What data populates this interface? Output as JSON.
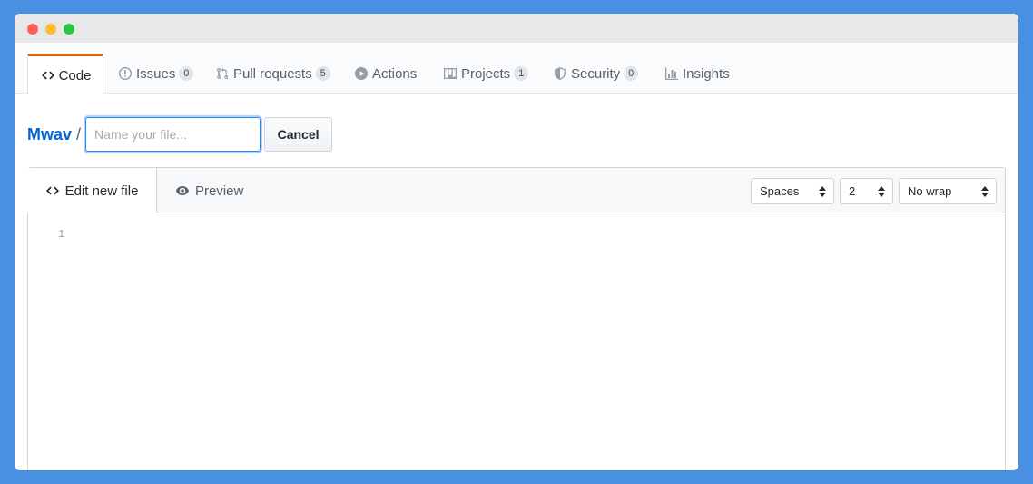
{
  "tabs": [
    {
      "label": "Code",
      "icon": "code-icon",
      "active": true
    },
    {
      "label": "Issues",
      "icon": "issue-icon",
      "count": "0"
    },
    {
      "label": "Pull requests",
      "icon": "pull-request-icon",
      "count": "5"
    },
    {
      "label": "Actions",
      "icon": "play-icon"
    },
    {
      "label": "Projects",
      "icon": "project-icon",
      "count": "1"
    },
    {
      "label": "Security",
      "icon": "shield-icon",
      "count": "0"
    },
    {
      "label": "Insights",
      "icon": "graph-icon"
    }
  ],
  "file": {
    "repo": "Mwav",
    "separator": "/",
    "placeholder": "Name your file...",
    "value": "",
    "cancel_label": "Cancel"
  },
  "editor": {
    "edit_tab": "Edit new file",
    "preview_tab": "Preview",
    "indent_mode": "Spaces",
    "indent_size": "2",
    "wrap_mode": "No wrap",
    "line_numbers": [
      "1"
    ]
  },
  "colors": {
    "background": "#4a90e2",
    "accent_tab_border": "#e36209",
    "link": "#0366d6",
    "focus": "#2188ff"
  }
}
